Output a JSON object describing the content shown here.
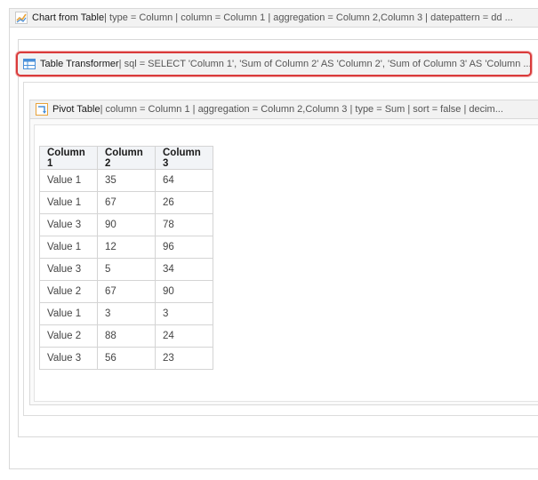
{
  "chart_macro": {
    "title": "Chart from Table",
    "params": " | type = Column | column = Column 1 | aggregation = Column 2,Column 3 | datepattern = dd ...",
    "icon": "chart-line-icon"
  },
  "transformer_macro": {
    "title": "Table Transformer",
    "params": " | sql = SELECT 'Column 1', 'Sum of Column 2' AS 'Column 2', 'Sum of Column 3' AS 'Column ...",
    "icon": "table-transformer-icon",
    "highlight_color": "#d93b3b"
  },
  "pivot_macro": {
    "title": "Pivot Table",
    "params": " | column = Column 1 | aggregation = Column 2,Column 3 | type = Sum | sort = false | decim...",
    "icon": "pivot-table-icon"
  },
  "table": {
    "headers": [
      "Column 1",
      "Column 2",
      "Column 3"
    ],
    "rows": [
      [
        "Value 1",
        "35",
        "64"
      ],
      [
        "Value 1",
        "67",
        "26"
      ],
      [
        "Value 3",
        "90",
        "78"
      ],
      [
        "Value 1",
        "12",
        "96"
      ],
      [
        "Value 3",
        "5",
        "34"
      ],
      [
        "Value 2",
        "67",
        "90"
      ],
      [
        "Value 1",
        "3",
        "3"
      ],
      [
        "Value 2",
        "88",
        "24"
      ],
      [
        "Value 3",
        "56",
        "23"
      ]
    ]
  }
}
